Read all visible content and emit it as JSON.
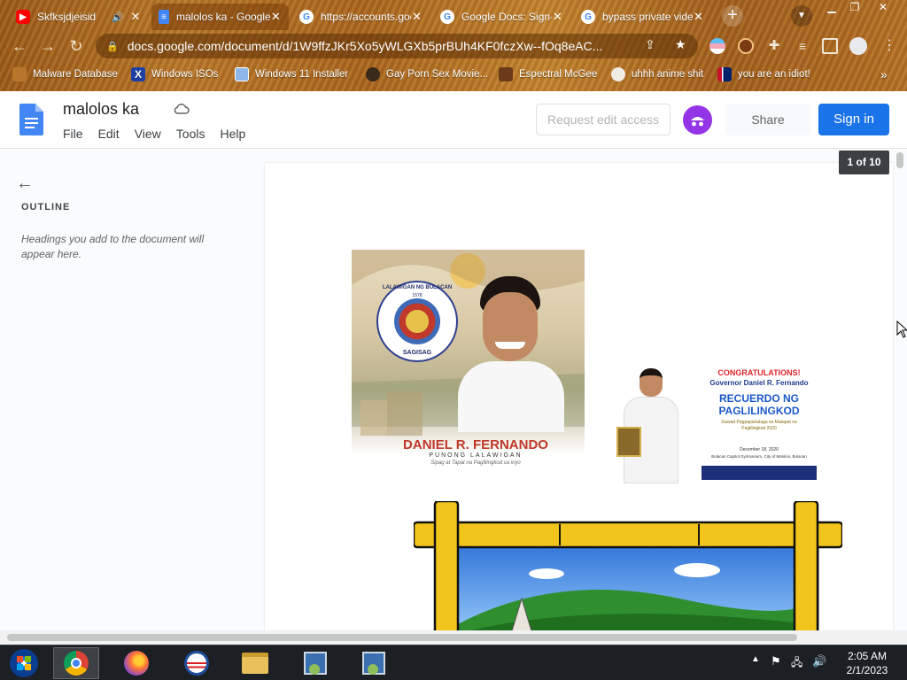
{
  "browser": {
    "tabs": [
      {
        "title": "Skfksjdjeisid",
        "favicon": "youtube-icon",
        "audio": true
      },
      {
        "title": "malolos ka - Google Docs",
        "favicon": "google-docs-icon",
        "active": true
      },
      {
        "title": "https://accounts.google.com",
        "favicon": "google-icon"
      },
      {
        "title": "Google Docs: Sign-in",
        "favicon": "google-icon"
      },
      {
        "title": "bypass private video",
        "favicon": "google-icon"
      }
    ],
    "url": "docs.google.com/document/d/1W9ffzJKr5Xo5yWLGXb5prBUh4KF0fczXw--fOq8eAC...",
    "bookmarks": [
      {
        "label": "Malware Database"
      },
      {
        "label": "Windows ISOs"
      },
      {
        "label": "Windows 11 Installer"
      },
      {
        "label": "Gay Porn Sex Movie..."
      },
      {
        "label": "Espectral McGee"
      },
      {
        "label": "uhhh anime shit"
      },
      {
        "label": "you are an idiot!"
      }
    ],
    "more_bookmarks": "»"
  },
  "docs": {
    "title": "malolos ka",
    "menus": [
      "File",
      "Edit",
      "View",
      "Tools",
      "Help"
    ],
    "request_edit_label": "Request edit access",
    "share_label": "Share",
    "signin_label": "Sign in",
    "page_indicator": "1 of 10"
  },
  "outline": {
    "title": "OUTLINE",
    "hint": "Headings you add to the document will appear here."
  },
  "content": {
    "poster1": {
      "seal_top": "LALAWIGAN NG BULACAN",
      "seal_year": "1578",
      "seal_bottom": "SAGISAG",
      "name": "DANIEL R. FERNANDO",
      "title": "PUNONG LALAWIGAN",
      "tagline": "Sipag at Tapat na Paglilingkod sa inyo"
    },
    "poster2": {
      "congrats": "CONGRATULATIONS!",
      "governor": "Governor Daniel R. Fernando",
      "award_line1": "RECUERDO NG",
      "award_line2": "PAGLILINGKOD",
      "award_sub": "Gawad Pagpapahalaga sa Matapat na Paglilingkod 2020",
      "date": "December 18, 2020",
      "venue": "Bulacan Capitol Gymnasium, City of Malolos, Bulacan"
    }
  },
  "taskbar": {
    "time": "2:05 AM",
    "date": "2/1/2023"
  }
}
